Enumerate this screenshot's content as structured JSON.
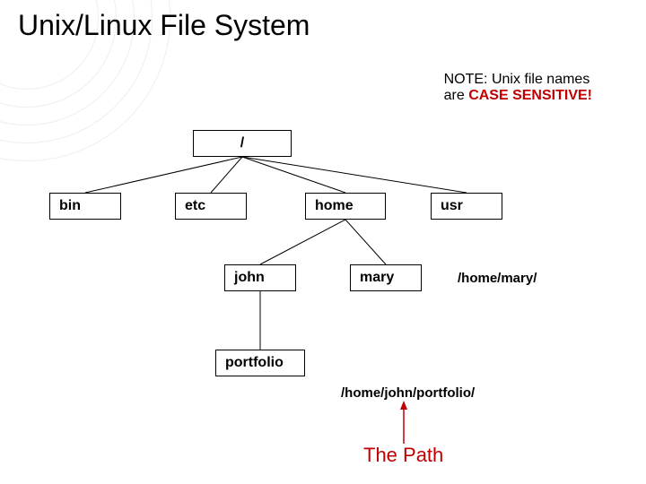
{
  "title": "Unix/Linux File System",
  "note_prefix": "NOTE: Unix file names",
  "note_are": "are ",
  "note_case": "CASE SENSITIVE!",
  "nodes": {
    "root": "/",
    "bin": "bin",
    "etc": "etc",
    "home": "home",
    "usr": "usr",
    "john": "john",
    "mary": "mary",
    "portfolio": "portfolio"
  },
  "labels": {
    "mary_path": "/home/mary/",
    "portfolio_path": "/home/john/portfolio/",
    "the_path": "The Path"
  }
}
